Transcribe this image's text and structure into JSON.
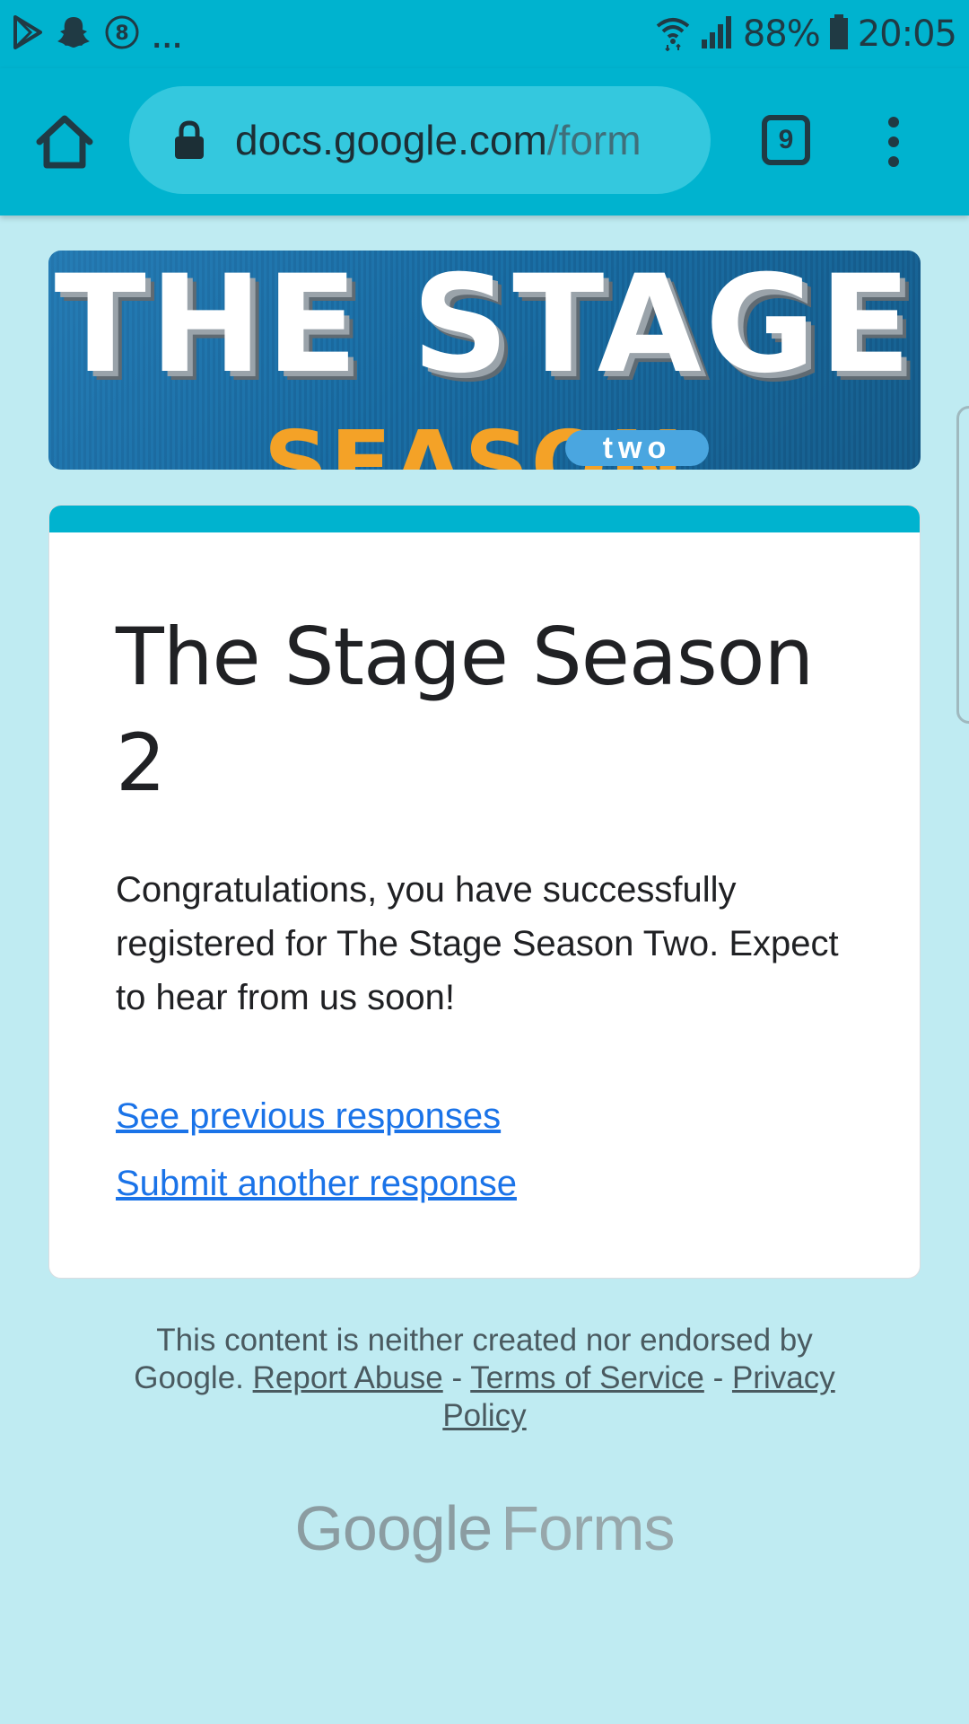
{
  "status_bar": {
    "battery": "88%",
    "time": "20:05",
    "notification_overflow": "...",
    "icons": [
      "play-store-icon",
      "snapchat-icon",
      "notification-8-icon",
      "wifi-icon",
      "signal-icon",
      "battery-icon"
    ],
    "notification_badge": "8"
  },
  "browser": {
    "url_domain": "docs.google.com",
    "url_path": "/form",
    "tab_count": "9"
  },
  "banner": {
    "title": "THE STAGE",
    "season": "SEASON",
    "badge": "two"
  },
  "card": {
    "accent_color": "#00b3cf",
    "title": "The Stage Season 2",
    "message": "Congratulations, you have successfully registered for The Stage Season Two. Expect to hear from us soon!",
    "link_previous": "See previous responses",
    "link_submit": "Submit another response"
  },
  "footer": {
    "text": "This content is neither created nor endorsed by Google.",
    "report_abuse": "Report Abuse",
    "separator": "-",
    "terms": "Terms of Service",
    "privacy": "Privacy Policy"
  },
  "brand": {
    "google": "Google",
    "forms": "Forms"
  }
}
